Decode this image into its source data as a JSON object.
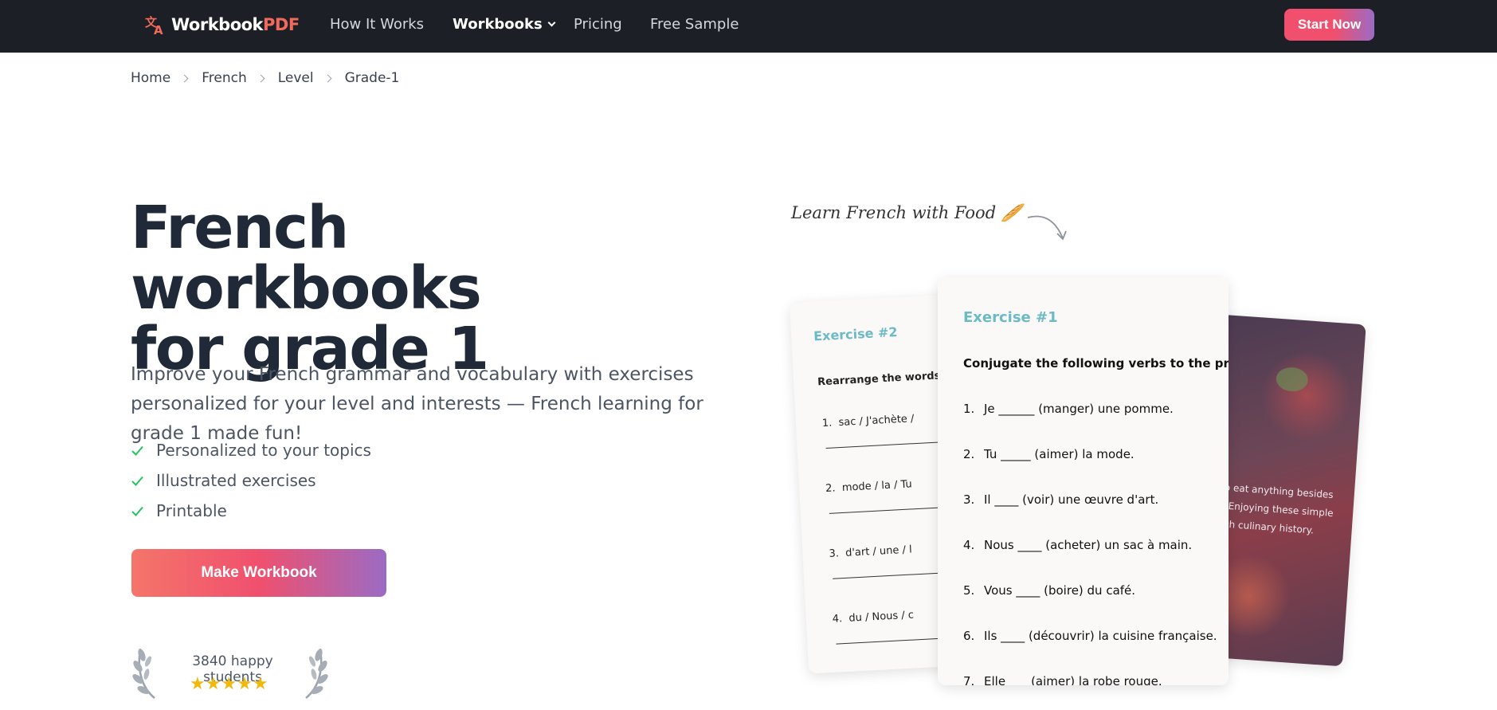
{
  "nav": {
    "logo_main": "Workbook",
    "logo_accent": "PDF",
    "links": [
      "How It Works",
      "Workbooks",
      "Pricing",
      "Free Sample"
    ],
    "cta": "Start Now"
  },
  "breadcrumb": [
    "Home",
    "French",
    "Level",
    "Grade-1"
  ],
  "hero": {
    "title_line1": "French workbooks",
    "title_line2": "for grade 1",
    "subtitle": "Improve your French grammar and vocabulary with exercises personalized for your level and interests — French learning for grade 1 made fun!",
    "features": [
      "Personalized to your topics",
      "Illustrated exercises",
      "Printable"
    ],
    "button": "Make Workbook",
    "happy_text": "3840 happy students",
    "stars": "★★★★★",
    "rating": 5
  },
  "preview": {
    "handwriting": "Learn French with Food 🥖",
    "back_card": {
      "title": "Exercise #2",
      "instruction": "Rearrange the words to",
      "items": [
        {
          "num": "1.",
          "words": "sac  /   J'achète  /"
        },
        {
          "num": "2.",
          "words": "mode  /   la  /   Tu"
        },
        {
          "num": "3.",
          "words": "d'art  /   une  /   l"
        },
        {
          "num": "4.",
          "words": "du  /   Nous  /   c"
        }
      ]
    },
    "front_card": {
      "title": "Exercise #1",
      "instruction": "Conjugate the following verbs to the present",
      "items": [
        {
          "num": "1.",
          "text": "Je ______ (manger) une pomme."
        },
        {
          "num": "2.",
          "text": "Tu _____ (aimer) la mode."
        },
        {
          "num": "3.",
          "text": "Il ____ (voir) une œuvre d'art."
        },
        {
          "num": "4.",
          "text": "Nous ____ (acheter) un sac à main."
        },
        {
          "num": "5.",
          "text": "Vous ____ (boire) du café."
        },
        {
          "num": "6.",
          "text": "Ils ____ (découvrir) la cuisine française."
        },
        {
          "num": "7.",
          "text": "Elle ___ (aimer) la robe rouge."
        }
      ]
    },
    "photo_card": {
      "lines": [
        "ion to eat anything besides",
        "neal. Enjoying these simple",
        "n's rich culinary history."
      ]
    }
  },
  "colors": {
    "nav_bg": "#1c1f26",
    "accent_coral": "#f26a5b",
    "accent_pink": "#f0506e",
    "accent_purple": "#9b6bc4",
    "check_green": "#22c55e",
    "exercise_title": "#6dbac7",
    "star": "#f0b90b"
  }
}
